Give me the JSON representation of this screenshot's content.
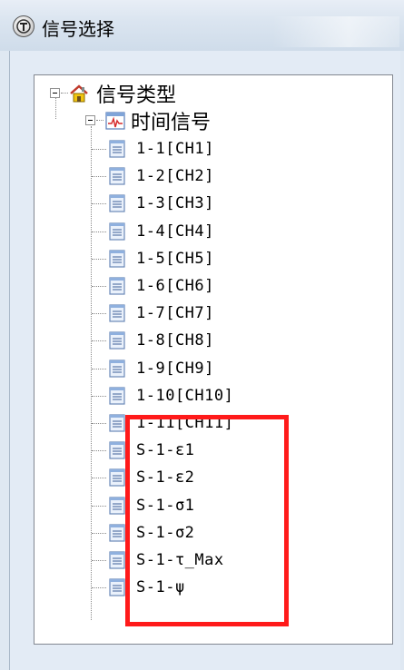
{
  "window": {
    "title": "信号选择"
  },
  "tree": {
    "root": {
      "label": "信号类型"
    },
    "group": {
      "label": "时间信号"
    },
    "leaves": [
      {
        "label": "1-1[CH1]"
      },
      {
        "label": "1-2[CH2]"
      },
      {
        "label": "1-3[CH3]"
      },
      {
        "label": "1-4[CH4]"
      },
      {
        "label": "1-5[CH5]"
      },
      {
        "label": "1-6[CH6]"
      },
      {
        "label": "1-7[CH7]"
      },
      {
        "label": "1-8[CH8]"
      },
      {
        "label": "1-9[CH9]"
      },
      {
        "label": "1-10[CH10]"
      },
      {
        "label": "1-11[CH11]"
      },
      {
        "label": "S-1-ε1"
      },
      {
        "label": "S-1-ε2"
      },
      {
        "label": "S-1-σ1"
      },
      {
        "label": "S-1-σ2"
      },
      {
        "label": "S-1-τ_Max"
      },
      {
        "label": "S-1-ψ"
      }
    ]
  },
  "annotation": {
    "highlight_color": "#ff1a1a"
  }
}
